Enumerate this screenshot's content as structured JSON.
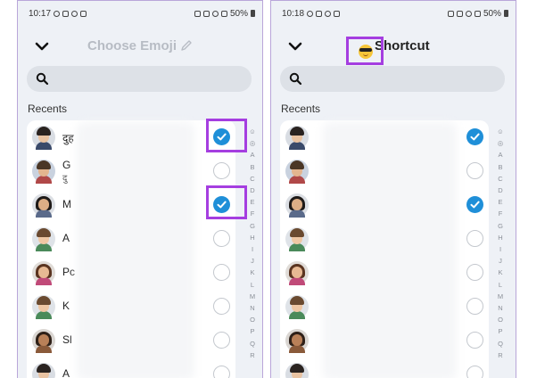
{
  "panels": [
    {
      "status_time": "10:17",
      "battery": "50%",
      "title": "Choose Emoji",
      "section": "Recents",
      "search_placeholder": "",
      "contacts": [
        {
          "name": "दुह",
          "sub": "",
          "checked": true,
          "avatar": "male-glasses"
        },
        {
          "name": "G",
          "sub": "दु",
          "checked": false,
          "avatar": "couple"
        },
        {
          "name": "M",
          "sub": "",
          "checked": true,
          "avatar": "female-dark"
        },
        {
          "name": "A",
          "sub": "",
          "checked": false,
          "avatar": "male-light"
        },
        {
          "name": "Pc",
          "sub": "",
          "checked": false,
          "avatar": "female-brown"
        },
        {
          "name": "K",
          "sub": "",
          "checked": false,
          "avatar": "male-light"
        },
        {
          "name": "Sl",
          "sub": "",
          "checked": false,
          "avatar": "female-curly"
        },
        {
          "name": "A",
          "sub": "",
          "checked": false,
          "avatar": "male-glasses"
        }
      ]
    },
    {
      "status_time": "10:18",
      "battery": "50%",
      "title": "Shortcut",
      "title_emoji": "sunglasses-face-icon",
      "section": "Recents",
      "search_placeholder": "",
      "contacts": [
        {
          "name": "",
          "sub": "",
          "checked": true,
          "avatar": "male-glasses"
        },
        {
          "name": "",
          "sub": "",
          "checked": false,
          "avatar": "couple"
        },
        {
          "name": "",
          "sub": "",
          "checked": true,
          "avatar": "female-dark"
        },
        {
          "name": "",
          "sub": "",
          "checked": false,
          "avatar": "male-light"
        },
        {
          "name": "",
          "sub": "",
          "checked": false,
          "avatar": "female-brown"
        },
        {
          "name": "",
          "sub": "",
          "checked": false,
          "avatar": "male-light"
        },
        {
          "name": "",
          "sub": "",
          "checked": false,
          "avatar": "female-curly"
        },
        {
          "name": "",
          "sub": "",
          "checked": false,
          "avatar": "male-glasses"
        }
      ]
    }
  ],
  "alphabet": [
    "☺",
    "◎",
    "A",
    "B",
    "C",
    "D",
    "E",
    "F",
    "G",
    "H",
    "I",
    "J",
    "K",
    "L",
    "M",
    "N",
    "O",
    "P",
    "Q",
    "R"
  ],
  "colors": {
    "accent": "#1f8fd8",
    "highlight": "#a53ee0",
    "background": "#eef1f6"
  }
}
